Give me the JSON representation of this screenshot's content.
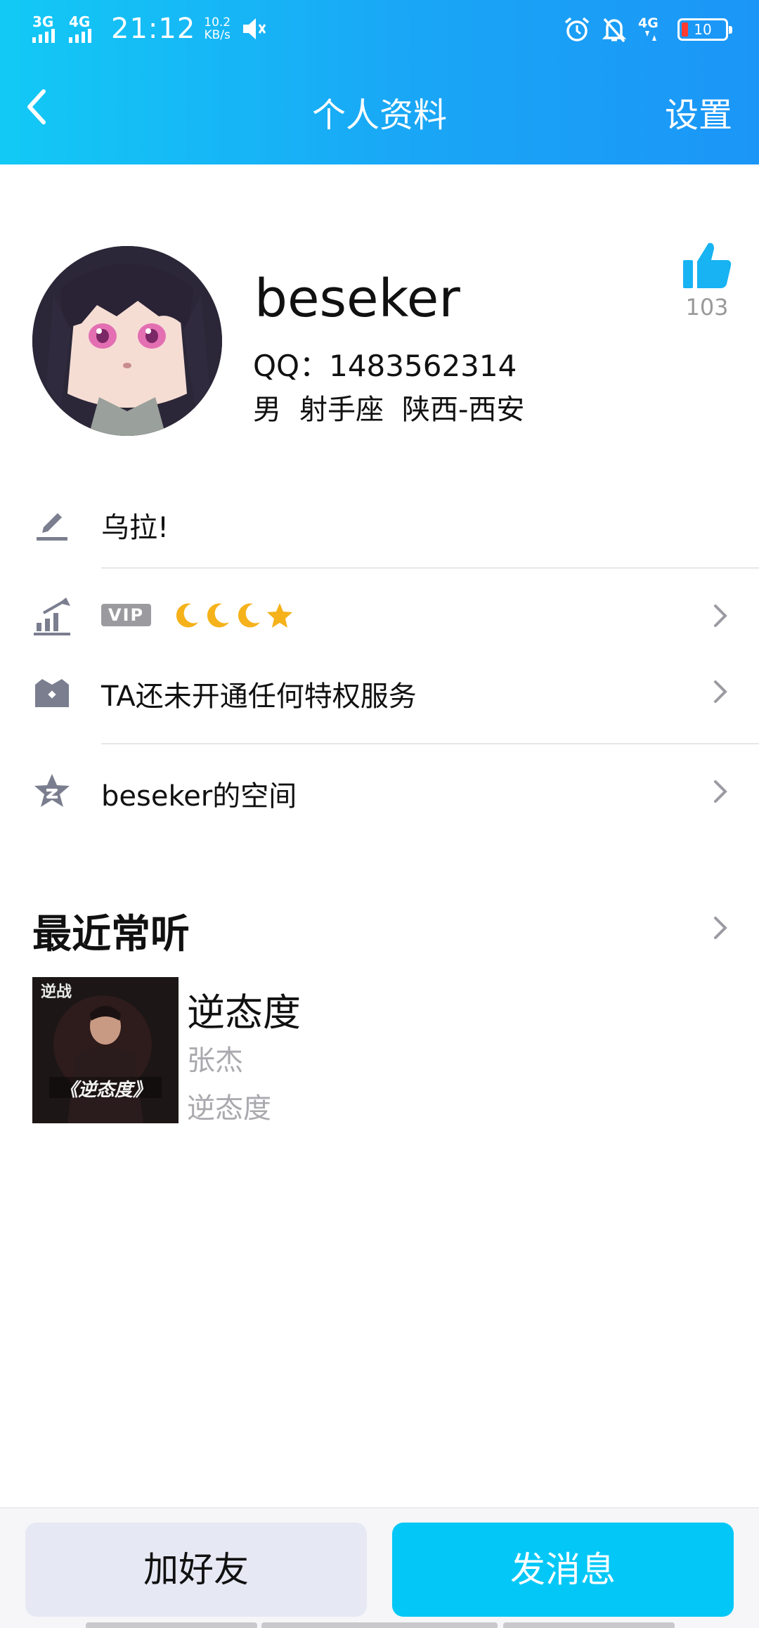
{
  "status_bar": {
    "net1": "3G",
    "net2": "4G",
    "time": "21:12",
    "speed_value": "10.2",
    "speed_unit": "KB/s",
    "net3": "4G",
    "battery": "10"
  },
  "nav": {
    "title": "个人资料",
    "settings": "设置"
  },
  "profile": {
    "name": "beseker",
    "qq": "QQ：1483562314",
    "gender": "男",
    "zodiac": "射手座",
    "location": "陕西-西安",
    "likes": "103"
  },
  "rows": {
    "signature": "乌拉!",
    "vip_badge": "VIP",
    "privilege": "TA还未开通任何特权服务",
    "space": "beseker的空间"
  },
  "recent": {
    "title": "最近常听",
    "song": "逆态度",
    "artist": "张杰",
    "album": "逆态度",
    "cover_text": "《逆态度》"
  },
  "actions": {
    "add_friend": "加好友",
    "send_message": "发消息"
  },
  "colors": {
    "header_start": "#12c9f5",
    "header_end": "#1b96f7",
    "accent": "#03c8f7",
    "like": "#17b3f3"
  }
}
